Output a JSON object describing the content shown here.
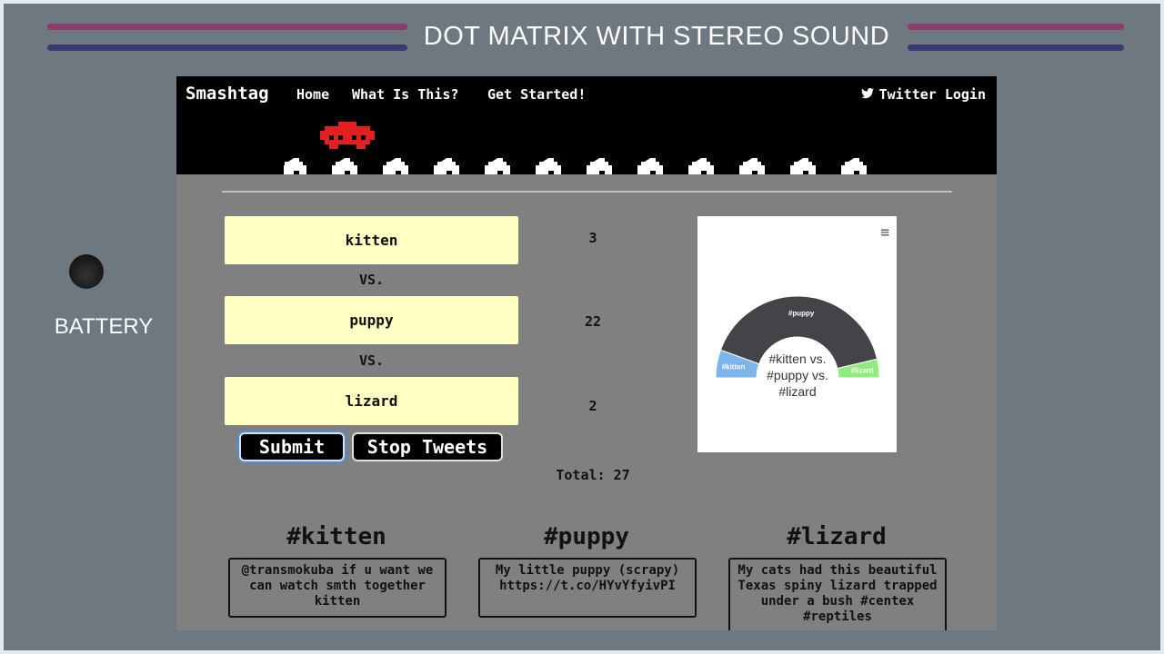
{
  "frame": {
    "title": "DOT MATRIX WITH STEREO SOUND",
    "battery_label": "BATTERY",
    "colors": {
      "deco_top": "#8d3b6b",
      "deco_bottom": "#3a3a6e",
      "background": "#6e7880"
    }
  },
  "nav": {
    "brand": "Smashtag",
    "links": [
      "Home",
      "What Is This?",
      "Get Started!"
    ],
    "login": "Twitter Login",
    "login_icon": "twitter-bird-icon"
  },
  "choices": [
    {
      "label": "kitten",
      "count": "3"
    },
    {
      "label": "puppy",
      "count": "22"
    },
    {
      "label": "lizard",
      "count": "2"
    }
  ],
  "vs_label": "VS.",
  "buttons": {
    "submit": "Submit",
    "stop": "Stop Tweets"
  },
  "total_label": "Total: 27",
  "chart_data": {
    "type": "pie",
    "title": "#kitten vs. #puppy vs. #lizard",
    "categories": [
      "#kitten",
      "#puppy",
      "#lizard"
    ],
    "values": [
      3,
      22,
      2
    ],
    "colors": [
      "#7cb5ec",
      "#434348",
      "#90ed7d"
    ],
    "menu_icon": "hamburger-menu-icon"
  },
  "columns": [
    {
      "tag": "#kitten",
      "tweet": "@transmokuba if u want we can watch smth together kitten"
    },
    {
      "tag": "#puppy",
      "tweet": "My little puppy (scrapy) https://t.co/HYvYfyivPI"
    },
    {
      "tag": "#lizard",
      "tweet": "My cats had this beautiful Texas spiny lizard trapped under a bush #centex #reptiles"
    }
  ]
}
